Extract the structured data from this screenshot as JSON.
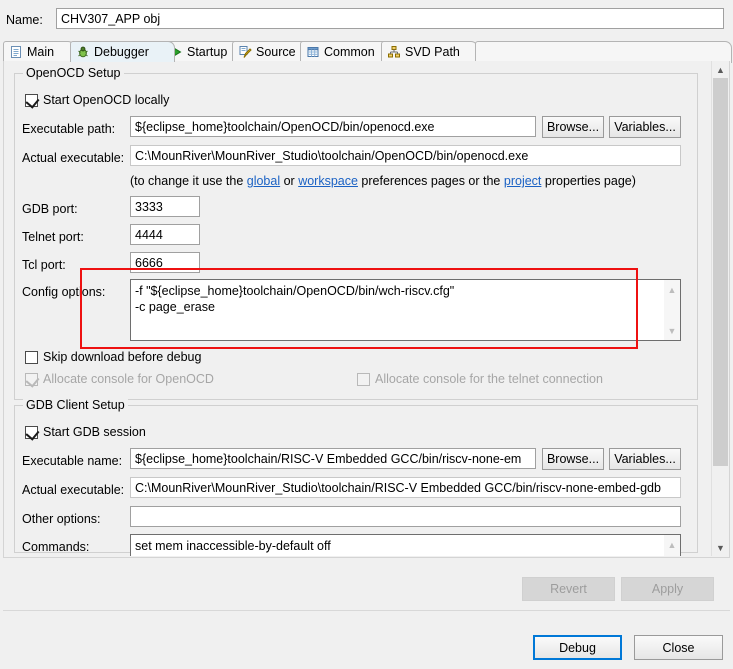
{
  "window": {
    "name_label": "Name:",
    "name_value": "CHV307_APP obj"
  },
  "tabs": [
    {
      "label": "Main",
      "icon": "document-icon",
      "selected": false
    },
    {
      "label": "Debugger",
      "icon": "bug-icon",
      "selected": true
    },
    {
      "label": "Startup",
      "icon": "play-icon",
      "selected": false
    },
    {
      "label": "Source",
      "icon": "source-edit-icon",
      "selected": false
    },
    {
      "label": "Common",
      "icon": "table-icon",
      "selected": false
    },
    {
      "label": "SVD Path",
      "icon": "hierarchy-icon",
      "selected": false
    }
  ],
  "openocd": {
    "group_title": "OpenOCD Setup",
    "start_locally": {
      "label": "Start OpenOCD locally",
      "checked": true,
      "enabled": true
    },
    "executable_path": {
      "label": "Executable path:",
      "value": "${eclipse_home}toolchain/OpenOCD/bin/openocd.exe",
      "browse": "Browse...",
      "variables": "Variables..."
    },
    "actual_executable": {
      "label": "Actual executable:",
      "value": "C:\\MounRiver\\MounRiver_Studio\\toolchain/OpenOCD/bin/openocd.exe"
    },
    "hint": {
      "pre": "(to change it use the ",
      "link1": "global",
      "mid1": " or ",
      "link2": "workspace",
      "mid2": " preferences pages or the ",
      "link3": "project",
      "post": " properties page)"
    },
    "gdb_port": {
      "label": "GDB port:",
      "value": "3333"
    },
    "telnet_port": {
      "label": "Telnet port:",
      "value": "4444"
    },
    "tcl_port": {
      "label": "Tcl port:",
      "value": "6666"
    },
    "config_options": {
      "label": "Config options:",
      "value": "-f \"${eclipse_home}toolchain/OpenOCD/bin/wch-riscv.cfg\"\n-c page_erase"
    },
    "skip_download": {
      "label": "Skip download before debug",
      "checked": false,
      "enabled": true
    },
    "allocate_console_openocd": {
      "label": "Allocate console for OpenOCD",
      "checked": true,
      "enabled": false
    },
    "allocate_console_telnet": {
      "label": "Allocate console for the telnet connection",
      "checked": false,
      "enabled": false
    }
  },
  "gdb_client": {
    "group_title": "GDB Client Setup",
    "start_session": {
      "label": "Start GDB session",
      "checked": true,
      "enabled": true
    },
    "executable_name": {
      "label": "Executable name:",
      "value": "${eclipse_home}toolchain/RISC-V Embedded GCC/bin/riscv-none-em",
      "browse": "Browse...",
      "variables": "Variables..."
    },
    "actual_executable": {
      "label": "Actual executable:",
      "value": "C:\\MounRiver\\MounRiver_Studio\\toolchain/RISC-V Embedded GCC/bin/riscv-none-embed-gdb"
    },
    "other_options": {
      "label": "Other options:",
      "value": ""
    },
    "commands": {
      "label": "Commands:",
      "value": "set mem inaccessible-by-default off"
    }
  },
  "footer": {
    "revert": "Revert",
    "apply": "Apply",
    "debug": "Debug",
    "close": "Close"
  },
  "annotation": {
    "color": "#ee1111",
    "target": "config-options-row"
  },
  "colors": {
    "link": "#1b62c4",
    "focus_border": "#0078d7",
    "selected_tab_bg": "#e9f2f7",
    "annotation_red": "#ee1111"
  },
  "scrollbar": {
    "up_glyph": "⌃",
    "down_glyph": "⌄"
  }
}
